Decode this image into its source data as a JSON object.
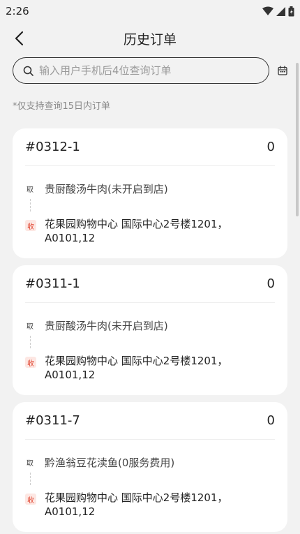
{
  "status_bar": {
    "time": "2:26"
  },
  "header": {
    "title": "历史订单"
  },
  "search": {
    "placeholder": "输入用户手机后4位查询订单"
  },
  "hint": "*仅支持查询15日内订单",
  "orders": [
    {
      "number": "#0312-1",
      "count": "0",
      "pickup_tag": "取",
      "pickup_name": "贵厨酸汤牛肉(未开启到店)",
      "deliver_tag": "收",
      "address_line1": "花果园购物中心 国际中心2号楼1201，",
      "address_line2": "A0101,12"
    },
    {
      "number": "#0311-1",
      "count": "0",
      "pickup_tag": "取",
      "pickup_name": "贵厨酸汤牛肉(未开启到店)",
      "deliver_tag": "收",
      "address_line1": "花果园购物中心 国际中心2号楼1201，",
      "address_line2": "A0101,12"
    },
    {
      "number": "#0311-7",
      "count": "0",
      "pickup_tag": "取",
      "pickup_name": "黔渔翁豆花渎鱼(0服务费用)",
      "deliver_tag": "收",
      "address_line1": "花果园购物中心 国际中心2号楼1201，",
      "address_line2": "A0101,12"
    }
  ],
  "colors": {
    "accent_red": "#e0442f",
    "background": "#f2f2f2"
  }
}
